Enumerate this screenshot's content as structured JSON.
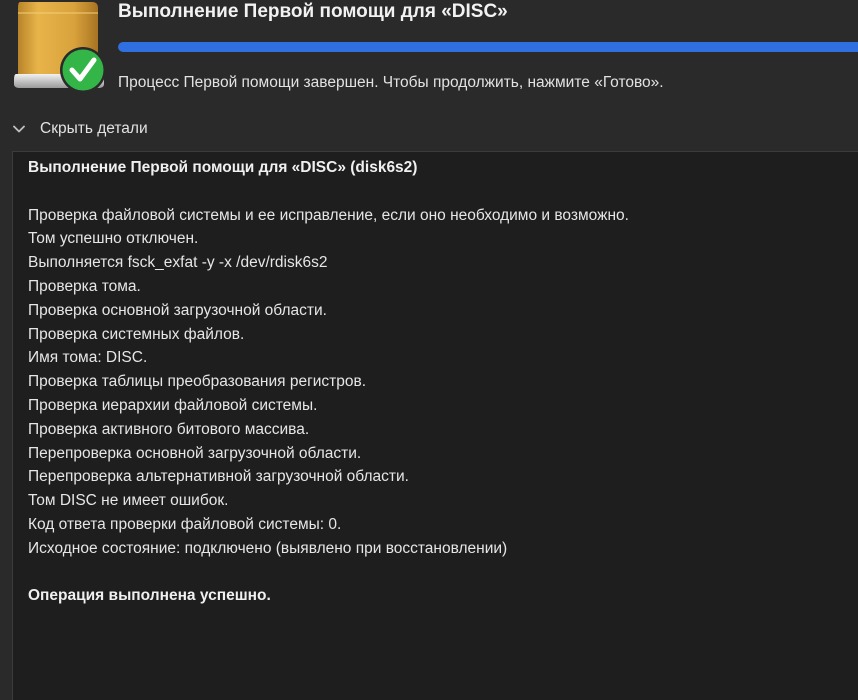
{
  "header": {
    "title": "Выполнение Первой помощи для «DISC»",
    "progress": 1.0,
    "status": "Процесс Первой помощи завершен. Чтобы продолжить, нажмите «Готово».",
    "disk_icon": "external-drive-icon",
    "check_icon": "checkmark-badge-icon"
  },
  "details": {
    "toggle_label": "Скрыть детали",
    "toggle_icon": "chevron-down-icon"
  },
  "log": {
    "lines": [
      {
        "text": "Выполнение Первой помощи для «DISC» (disk6s2)",
        "bold": true
      },
      {
        "text": "",
        "bold": false
      },
      {
        "text": "Проверка файловой системы и ее исправление, если оно необходимо и возможно.",
        "bold": false
      },
      {
        "text": "Том успешно отключен.",
        "bold": false
      },
      {
        "text": "Выполняется fsck_exfat -y -x /dev/rdisk6s2",
        "bold": false
      },
      {
        "text": "Проверка тома.",
        "bold": false
      },
      {
        "text": "Проверка основной загрузочной области.",
        "bold": false
      },
      {
        "text": "Проверка системных файлов.",
        "bold": false
      },
      {
        "text": "Имя тома: DISC.",
        "bold": false
      },
      {
        "text": "Проверка таблицы преобразования регистров.",
        "bold": false
      },
      {
        "text": "Проверка иерархии файловой системы.",
        "bold": false
      },
      {
        "text": "Проверка активного битового массива.",
        "bold": false
      },
      {
        "text": "Перепроверка основной загрузочной области.",
        "bold": false
      },
      {
        "text": "Перепроверка альтернативной загрузочной области.",
        "bold": false
      },
      {
        "text": "Том DISC не имеет ошибок.",
        "bold": false
      },
      {
        "text": "Код ответа проверки файловой системы: 0.",
        "bold": false
      },
      {
        "text": "Исходное состояние: подключено (выявлено при восстановлении)",
        "bold": false
      },
      {
        "text": "",
        "bold": false
      },
      {
        "text": "Операция выполнена успешно.",
        "bold": true
      }
    ]
  },
  "colors": {
    "background": "#2b2a2b",
    "log_background": "#1f1e1f",
    "progress_accent": "#2f6fe0",
    "success_green": "#34b548",
    "drive_gold": "#e0a93a"
  }
}
